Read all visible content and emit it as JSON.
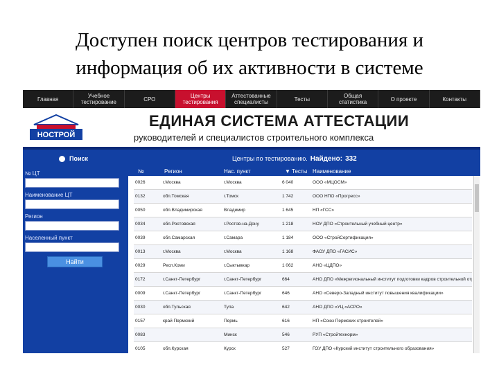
{
  "slide": {
    "title_line1": "Доступен поиск центров тестирования и",
    "title_line2": "информация об их активности в системе"
  },
  "nav": {
    "items": [
      "Главная",
      "Учебное\nтестирование",
      "СРО",
      "Центры\nтестирования",
      "Аттестованные\nспециалисты",
      "Тесты",
      "Общая\nстатистика",
      "О проекте",
      "Контакты"
    ],
    "active_index": 3
  },
  "banner": {
    "logo_text": "НОСТРОЙ",
    "title": "ЕДИНАЯ СИСТЕМА АТТЕСТАЦИИ",
    "subtitle": "руководителей и специалистов строительного комплекса"
  },
  "search": {
    "heading": "Поиск",
    "field_id": "№ ЦТ",
    "field_name": "Наименование ЦТ",
    "field_region": "Регион",
    "field_city": "Населенный пункт",
    "button": "Найти"
  },
  "results": {
    "heading": "Центры по тестированию.",
    "found_label": "Найдено:",
    "found_count": "332",
    "columns": [
      "№",
      "Регион",
      "Нас. пункт",
      "Тесты",
      "Наименование"
    ],
    "rows": [
      [
        "0026",
        "г.Москва",
        "г.Москва",
        "6 040",
        "ООО «МЦОСМ»"
      ],
      [
        "0132",
        "обл.Томская",
        "г.Томск",
        "1 742",
        "ООО НПО «Прогресс»"
      ],
      [
        "0050",
        "обл.Владимирская",
        "Владимир",
        "1 645",
        "НП «ГСС»"
      ],
      [
        "0034",
        "обл.Ростовская",
        "г.Ростов-на-Дону",
        "1 218",
        "НОУ ДПО «Строительный учебный центр»"
      ],
      [
        "0039",
        "обл.Самарская",
        "г.Самара",
        "1 184",
        "ООО «СтройСертификация»"
      ],
      [
        "0013",
        "г.Москва",
        "г.Москва",
        "1 168",
        "ФАОУ ДПО «ГАСИС»"
      ],
      [
        "0029",
        "Респ.Коми",
        "г.Сыктывкар",
        "1 062",
        "АНО «ЦДПО»"
      ],
      [
        "0172",
        "г.Санкт-Петербург",
        "г.Санкт-Петербург",
        "664",
        "АНО ДПО «Межрегиональный институт подготовки кадров строительной отрасли»"
      ],
      [
        "0009",
        "г.Санкт-Петербург",
        "г.Санкт-Петербург",
        "646",
        "АНО «Северо-Западный институт повышения квалификации»"
      ],
      [
        "0030",
        "обл.Тульская",
        "Тула",
        "642",
        "АНО ДПО «УЦ «АСРО»"
      ],
      [
        "0157",
        "край Пермский",
        "Пермь",
        "616",
        "НП «Союз Пермских строителей»"
      ],
      [
        "0083",
        "",
        "Минск",
        "546",
        "РУП «Стройтехнорм»"
      ],
      [
        "0105",
        "обл.Курская",
        "Курск",
        "527",
        "ГОУ ДПО «Курский институт строительного образования»"
      ]
    ]
  },
  "colors": {
    "nav_bg": "#1c1c1c",
    "nav_active": "#c8102e",
    "panel_blue": "#1240a3",
    "button_blue": "#4a90e2"
  }
}
